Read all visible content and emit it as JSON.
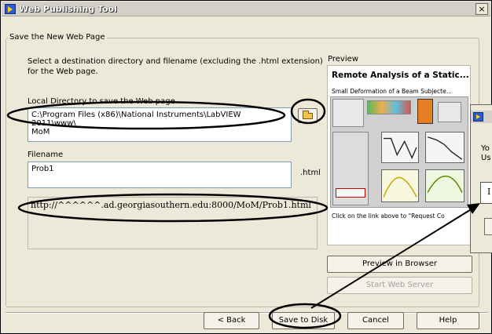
{
  "window": {
    "title": "Web Publishing Tool",
    "close_glyph": "×"
  },
  "group": {
    "label": "Save the New Web Page"
  },
  "instructions": {
    "line1": "Select a destination directory and filename (excluding the .html extension)",
    "line2": "for the Web page."
  },
  "directory": {
    "label": "Local Directory to save the Web page",
    "value_line1": "C:\\Program Files (x86)\\National Instruments\\LabVIEW 2011\\www\\",
    "value_line2": "MoM"
  },
  "filename": {
    "label": "Filename",
    "value": "Prob1",
    "extension": ".html"
  },
  "url": {
    "value": "http://^^^^^^.ad.georgiasouthern.edu:8000/MoM/Prob1.html"
  },
  "preview": {
    "label": "Preview",
    "title": "Remote Analysis of a Static...",
    "subtitle": "Small Deformation of a Beam Subjecte...",
    "caption": "Click on the link above to \"Request Co"
  },
  "buttons": {
    "preview_in_browser": "Preview in Browser",
    "start_web_server": "Start Web Server",
    "back": "< Back",
    "save_to_disk": "Save to Disk",
    "cancel": "Cancel",
    "help": "Help"
  },
  "popup": {
    "text_line1": "Yo",
    "text_line2": "Us",
    "field_text": "I"
  },
  "colors": {
    "annotation": "#000000",
    "window_bg": "#ece9d8",
    "title_icon": "#2a5bd7"
  },
  "icons": {
    "title": "labview-icon",
    "browse": "folder-open-icon",
    "close": "close-icon"
  }
}
